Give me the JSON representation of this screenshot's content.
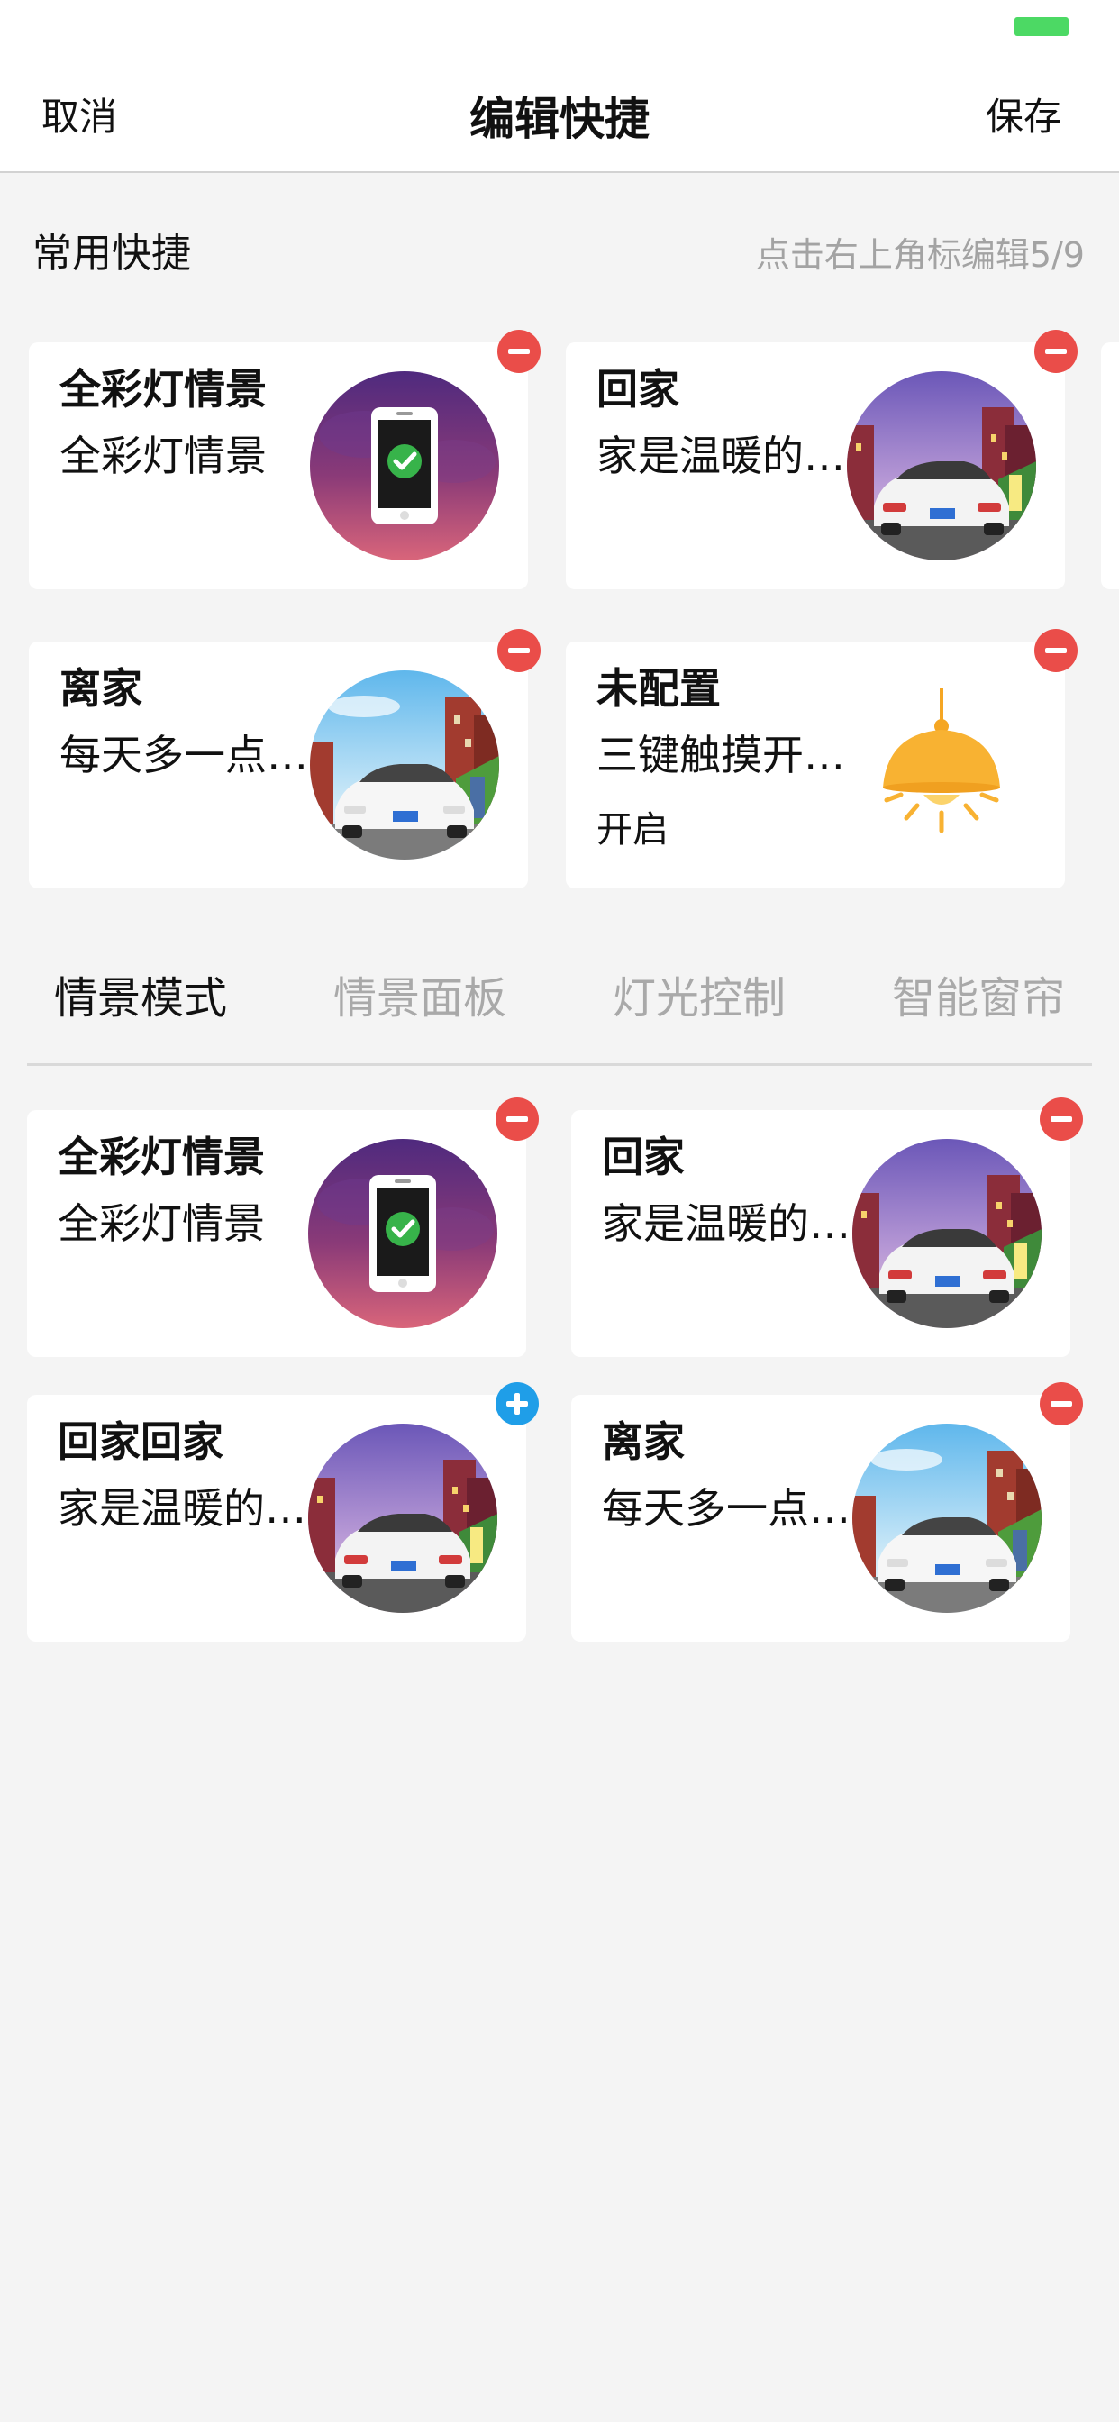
{
  "nav": {
    "cancel": "取消",
    "title": "编辑快捷",
    "save": "保存"
  },
  "section": {
    "title": "常用快捷",
    "hint": "点击右上角标编辑5/9"
  },
  "favorites": [
    {
      "title": "全彩灯情景",
      "desc": "全彩灯情景",
      "sub": "",
      "icon": "phone-check-icon",
      "badge": "remove"
    },
    {
      "title": "回家",
      "desc": "家是温暖的…",
      "sub": "",
      "icon": "car-dusk-icon",
      "badge": "remove"
    },
    {
      "title": "离家",
      "desc": "每天多一点…",
      "sub": "",
      "icon": "car-day-icon",
      "badge": "remove"
    },
    {
      "title": "未配置",
      "desc": "三键触摸开…",
      "sub": "开启",
      "icon": "lamp-icon",
      "badge": "remove"
    }
  ],
  "tabs": [
    {
      "label": "情景模式",
      "active": true
    },
    {
      "label": "情景面板",
      "active": false
    },
    {
      "label": "灯光控制",
      "active": false
    },
    {
      "label": "智能窗帘",
      "active": false
    }
  ],
  "scenes": [
    {
      "title": "全彩灯情景",
      "desc": "全彩灯情景",
      "icon": "phone-check-icon",
      "badge": "remove"
    },
    {
      "title": "回家",
      "desc": "家是温暖的…",
      "icon": "car-dusk-icon",
      "badge": "remove"
    },
    {
      "title": "回家回家",
      "desc": "家是温暖的…",
      "icon": "car-dusk-icon",
      "badge": "add"
    },
    {
      "title": "离家",
      "desc": "每天多一点…",
      "icon": "car-day-icon",
      "badge": "remove"
    }
  ],
  "colors": {
    "remove_badge": "#ea4d49",
    "add_badge": "#1f9ee8",
    "battery": "#4cd964",
    "hint_text": "#a3a3a3",
    "inactive_tab": "#a9a9a9"
  }
}
